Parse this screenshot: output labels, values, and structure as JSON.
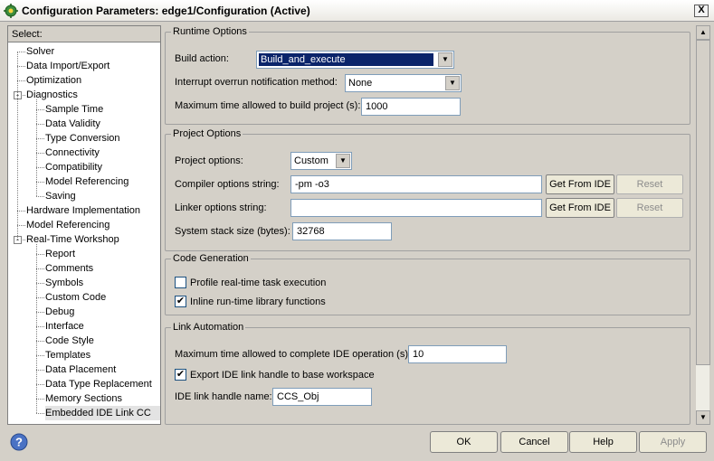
{
  "window": {
    "title": "Configuration Parameters: edge1/Configuration (Active)",
    "close_label": "X"
  },
  "tree": {
    "header": "Select:",
    "items": [
      {
        "label": "Solver",
        "indent": 0
      },
      {
        "label": "Data Import/Export",
        "indent": 0
      },
      {
        "label": "Optimization",
        "indent": 0
      },
      {
        "label": "Diagnostics",
        "indent": 0,
        "expander": "-"
      },
      {
        "label": "Sample Time",
        "indent": 1
      },
      {
        "label": "Data Validity",
        "indent": 1
      },
      {
        "label": "Type Conversion",
        "indent": 1
      },
      {
        "label": "Connectivity",
        "indent": 1
      },
      {
        "label": "Compatibility",
        "indent": 1
      },
      {
        "label": "Model Referencing",
        "indent": 1
      },
      {
        "label": "Saving",
        "indent": 1
      },
      {
        "label": "Hardware Implementation",
        "indent": 0
      },
      {
        "label": "Model Referencing",
        "indent": 0
      },
      {
        "label": "Real-Time Workshop",
        "indent": 0,
        "expander": "-"
      },
      {
        "label": "Report",
        "indent": 1
      },
      {
        "label": "Comments",
        "indent": 1
      },
      {
        "label": "Symbols",
        "indent": 1
      },
      {
        "label": "Custom Code",
        "indent": 1
      },
      {
        "label": "Debug",
        "indent": 1
      },
      {
        "label": "Interface",
        "indent": 1
      },
      {
        "label": "Code Style",
        "indent": 1
      },
      {
        "label": "Templates",
        "indent": 1
      },
      {
        "label": "Data Placement",
        "indent": 1
      },
      {
        "label": "Data Type Replacement",
        "indent": 1
      },
      {
        "label": "Memory Sections",
        "indent": 1
      },
      {
        "label": "Embedded IDE Link CC",
        "indent": 1,
        "selected": true
      }
    ]
  },
  "runtime": {
    "title": "Runtime Options",
    "build_action_label": "Build action:",
    "build_action_value": "Build_and_execute",
    "interrupt_label": "Interrupt overrun notification method:",
    "interrupt_value": "None",
    "max_time_label": "Maximum time allowed to build project (s):",
    "max_time_value": "1000"
  },
  "project": {
    "title": "Project Options",
    "options_label": "Project options:",
    "options_value": "Custom",
    "compiler_label": "Compiler options string:",
    "compiler_value": "-pm -o3",
    "linker_label": "Linker options string:",
    "linker_value": "",
    "stack_label": "System stack size (bytes):",
    "stack_value": "32768",
    "get_from_ide": "Get From IDE",
    "reset": "Reset"
  },
  "codegen": {
    "title": "Code Generation",
    "profile_label": "Profile real-time task execution",
    "profile_checked": false,
    "inline_label": "Inline run-time library functions",
    "inline_checked": true
  },
  "link": {
    "title": "Link Automation",
    "max_ide_label": "Maximum time allowed to complete IDE operation (s):",
    "max_ide_value": "10",
    "export_label": "Export IDE link handle to base workspace",
    "export_checked": true,
    "handle_name_label": "IDE link handle name:",
    "handle_name_value": "CCS_Obj"
  },
  "buttons": {
    "ok": "OK",
    "cancel": "Cancel",
    "help": "Help",
    "apply": "Apply"
  },
  "icons": {
    "title": "simulink-gear-icon",
    "help": "help-icon"
  },
  "colors": {
    "selection": "#0a246a",
    "panel": "#d4d0c8",
    "disabled_text": "#8c8c8c"
  }
}
